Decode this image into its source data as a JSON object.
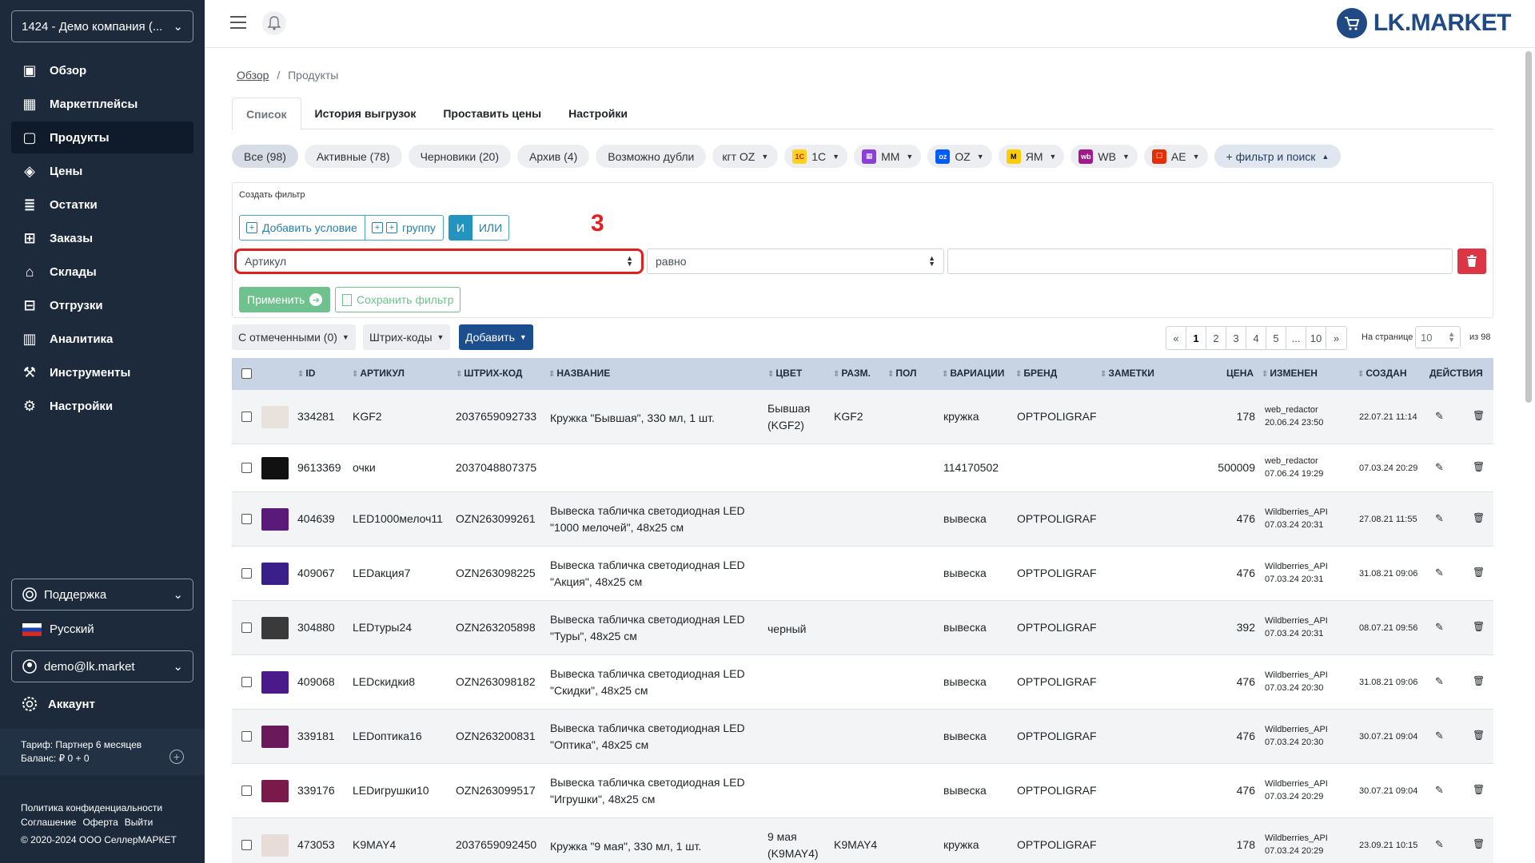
{
  "sidebar": {
    "company": "1424 - Демо компания (...",
    "items": [
      {
        "label": "Обзор",
        "icon": "dashboard-icon"
      },
      {
        "label": "Маркетплейсы",
        "icon": "grid-icon"
      },
      {
        "label": "Продукты",
        "icon": "box-icon"
      },
      {
        "label": "Цены",
        "icon": "tag-icon"
      },
      {
        "label": "Остатки",
        "icon": "stack-icon"
      },
      {
        "label": "Заказы",
        "icon": "cart-icon"
      },
      {
        "label": "Склады",
        "icon": "warehouse-icon"
      },
      {
        "label": "Отгрузки",
        "icon": "shipment-icon"
      },
      {
        "label": "Аналитика",
        "icon": "chart-icon"
      },
      {
        "label": "Инструменты",
        "icon": "tools-icon"
      },
      {
        "label": "Настройки",
        "icon": "gear-icon"
      }
    ],
    "support": "Поддержка",
    "language": "Русский",
    "user": "demo@lk.market",
    "account": "Аккаунт",
    "tariff": "Тариф: Партнер 6 месяцев",
    "balance": "Баланс: ₽ 0 + 0",
    "footer": {
      "privacy": "Политика конфиденциальности",
      "agreement": "Соглашение",
      "offer": "Оферта",
      "logout": "Выйти",
      "copyright": "© 2020-2024 ООО СеллерМАРКЕТ"
    }
  },
  "header": {
    "logo": "LK.MARKET"
  },
  "breadcrumb": {
    "home": "Обзор",
    "separator": "/",
    "current": "Продукты"
  },
  "tabs": [
    "Список",
    "История выгрузок",
    "Проставить цены",
    "Настройки"
  ],
  "chips": {
    "all": "Все (98)",
    "active": "Активные (78)",
    "drafts": "Черновики (20)",
    "archive": "Архив (4)",
    "dupes": "Возможно дубли",
    "kt_oz": "кгт OZ",
    "c1": "1С",
    "mm": "ММ",
    "oz": "OZ",
    "ym": "ЯМ",
    "wb": "WB",
    "ae": "AE",
    "filter": "+ фильтр и поиск"
  },
  "filter": {
    "title": "Создать фильтр",
    "add_condition": "Добавить условие",
    "add_group": "группу",
    "and": "И",
    "or": "ИЛИ",
    "marker": "3",
    "field": "Артикул",
    "operator": "равно",
    "value": "",
    "apply": "Применить",
    "save": "Сохранить фильтр"
  },
  "toolbar": {
    "selected": "С отмеченными (0)",
    "barcodes": "Штрих-коды",
    "add": "Добавить",
    "pages": [
      "«",
      "1",
      "2",
      "3",
      "4",
      "5",
      "...",
      "10",
      "»"
    ],
    "per_page_label": "На странице",
    "per_page": "10",
    "of": "из 98"
  },
  "table": {
    "headers": {
      "id": "ID",
      "sku": "АРТИКУЛ",
      "barcode": "ШТРИХ-КОД",
      "name": "НАЗВАНИЕ",
      "color": "ЦВЕТ",
      "size": "РАЗМ.",
      "gender": "ПОЛ",
      "variation": "ВАРИАЦИИ",
      "brand": "БРЕНД",
      "notes": "ЗАМЕТКИ",
      "price": "ЦЕНА",
      "changed": "ИЗМЕНЕН",
      "created": "СОЗДАН",
      "actions": "ДЕЙСТВИЯ"
    },
    "rows": [
      {
        "id": "334281",
        "sku": "KGF2",
        "barcode": "2037659092733",
        "name": "Кружка \"Бывшая\", 330 мл, 1 шт.",
        "color": "Бывшая (KGF2)",
        "size": "KGF2",
        "variation": "кружка",
        "brand": "OPTPOLIGRAF",
        "price": "178",
        "changed_by": "web_redactor",
        "changed_at": "20.06.24 23:50",
        "created": "22.07.21 11:14",
        "thumb": "#e8e2dc"
      },
      {
        "id": "9613369",
        "sku": "очки",
        "barcode": "2037048807375",
        "name": "",
        "color": "",
        "size": "",
        "variation": "114170502",
        "brand": "",
        "price": "500009",
        "changed_by": "web_redactor",
        "changed_at": "07.06.24 19:29",
        "created": "07.03.24 20:29",
        "thumb": "#111111"
      },
      {
        "id": "404639",
        "sku": "LED1000мелоч11",
        "barcode": "OZN263099261",
        "name": "Вывеска табличка светодиодная LED \"1000 мелочей\", 48x25 см",
        "color": "",
        "size": "",
        "variation": "вывеска",
        "brand": "OPTPOLIGRAF",
        "price": "476",
        "changed_by": "Wildberries_API",
        "changed_at": "07.03.24 20:31",
        "created": "27.08.21 11:55",
        "thumb": "#5a1a7a"
      },
      {
        "id": "409067",
        "sku": "LEDакция7",
        "barcode": "OZN263098225",
        "name": "Вывеска табличка светодиодная LED \"Акция\", 48x25 см",
        "color": "",
        "size": "",
        "variation": "вывеска",
        "brand": "OPTPOLIGRAF",
        "price": "476",
        "changed_by": "Wildberries_API",
        "changed_at": "07.03.24 20:31",
        "created": "31.08.21 09:06",
        "thumb": "#3a1f8a"
      },
      {
        "id": "304880",
        "sku": "LEDтуры24",
        "barcode": "OZN263205898",
        "name": "Вывеска табличка светодиодная LED \"Туры\", 48x25 см",
        "color": "черный",
        "size": "",
        "variation": "вывеска",
        "brand": "OPTPOLIGRAF",
        "price": "392",
        "changed_by": "Wildberries_API",
        "changed_at": "07.03.24 20:31",
        "created": "08.07.21 09:56",
        "thumb": "#3a3a3a"
      },
      {
        "id": "409068",
        "sku": "LEDскидки8",
        "barcode": "OZN263098182",
        "name": "Вывеска табличка светодиодная LED \"Скидки\", 48x25 см",
        "color": "",
        "size": "",
        "variation": "вывеска",
        "brand": "OPTPOLIGRAF",
        "price": "476",
        "changed_by": "Wildberries_API",
        "changed_at": "07.03.24 20:30",
        "created": "31.08.21 09:06",
        "thumb": "#4a1a8a"
      },
      {
        "id": "339181",
        "sku": "LEDоптика16",
        "barcode": "OZN263200831",
        "name": "Вывеска табличка светодиодная LED \"Оптика\", 48x25 см",
        "color": "",
        "size": "",
        "variation": "вывеска",
        "brand": "OPTPOLIGRAF",
        "price": "476",
        "changed_by": "Wildberries_API",
        "changed_at": "07.03.24 20:30",
        "created": "30.07.21 09:04",
        "thumb": "#6a1a5a"
      },
      {
        "id": "339176",
        "sku": "LEDигрушки10",
        "barcode": "OZN263099517",
        "name": "Вывеска табличка светодиодная LED \"Игрушки\", 48x25 см",
        "color": "",
        "size": "",
        "variation": "вывеска",
        "brand": "OPTPOLIGRAF",
        "price": "476",
        "changed_by": "Wildberries_API",
        "changed_at": "07.03.24 20:29",
        "created": "30.07.21 09:04",
        "thumb": "#7a1a4a"
      },
      {
        "id": "473053",
        "sku": "K9MAY4",
        "barcode": "2037659092450",
        "name": "Кружка \"9 мая\", 330 мл, 1 шт.",
        "color": "9 мая (K9MAY4)",
        "size": "K9MAY4",
        "variation": "кружка",
        "brand": "OPTPOLIGRAF",
        "price": "178",
        "changed_by": "Wildberries_API",
        "changed_at": "07.03.24 20:29",
        "created": "23.09.21 10:15",
        "thumb": "#e8dcd8"
      }
    ]
  },
  "colors": {
    "sidebar": "#1c2a3b",
    "accent": "#1c4d8c",
    "danger": "#dc3545",
    "success": "#6fc28d",
    "highlight": "#e02020"
  }
}
